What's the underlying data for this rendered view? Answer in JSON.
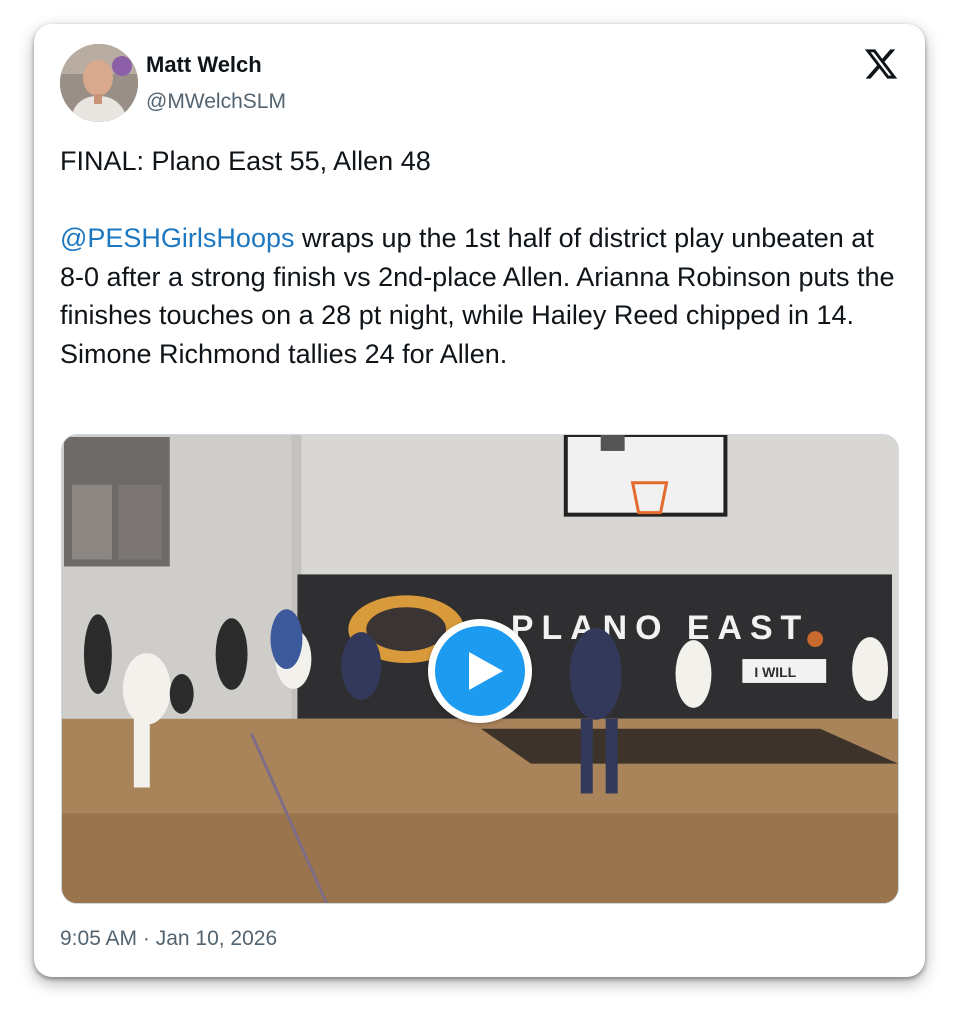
{
  "author": {
    "display_name": "Matt Welch",
    "handle": "@MWelchSLM",
    "avatar_icon": "user-avatar"
  },
  "platform_icon": "x-logo-icon",
  "tweet": {
    "headline": "FINAL: Plano East 55, Allen 48",
    "mention": "@PESHGirlsHoops",
    "body_after_mention": " wraps up the 1st half of district play unbeaten at 8-0 after a strong finish vs 2nd-place Allen. Arianna Robinson puts the finishes touches on a 28 pt night, while Hailey Reed chipped in 14. Simone Richmond tallies 24 for Allen."
  },
  "media": {
    "type": "video",
    "play_icon": "play-icon",
    "wall_lettering": "PLANO EAST",
    "banner_text": "I WILL"
  },
  "timestamp": "9:05 AM · Jan 10, 2026",
  "colors": {
    "link": "#1d78c2",
    "play_button": "#1d9bf0",
    "text": "#0f1419",
    "secondary_text": "#536471"
  }
}
